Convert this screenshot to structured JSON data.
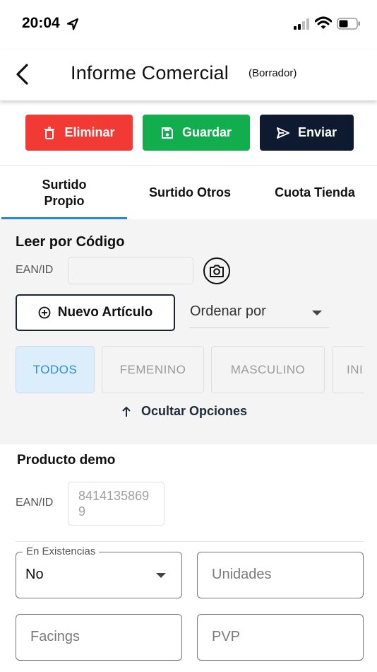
{
  "status_bar": {
    "time": "20:04",
    "icons": [
      "location-arrow-icon",
      "signal-icon",
      "wifi-icon",
      "battery-icon"
    ]
  },
  "header": {
    "title": "Informe Comercial",
    "subtitle": "(Borrador)",
    "back_icon": "chevron-left-icon"
  },
  "actions": {
    "delete_label": "Eliminar",
    "save_label": "Guardar",
    "send_label": "Enviar",
    "colors": {
      "delete": "#f03a33",
      "save": "#12ad4c",
      "send": "#0e1a30"
    }
  },
  "tabs": [
    {
      "line1": "Surtido",
      "line2": "Propio",
      "active": true
    },
    {
      "line1": "Surtido Otros",
      "line2": "",
      "active": false
    },
    {
      "line1": "Cuota Tienda",
      "line2": "",
      "active": false
    }
  ],
  "scan": {
    "title": "Leer por Código",
    "ean_label": "EAN/ID",
    "ean_value": ""
  },
  "new_article_label": "Nuevo Artículo",
  "sort": {
    "label": "Ordenar por"
  },
  "filters": [
    {
      "label": "TODOS",
      "active": true
    },
    {
      "label": "FEMENINO",
      "active": false
    },
    {
      "label": "MASCULINO",
      "active": false
    },
    {
      "label": "INI",
      "active": false
    }
  ],
  "hide_options_label": "Ocultar Opciones",
  "product": {
    "name": "Producto demo",
    "ean_label": "EAN/ID",
    "ean_value": "84141358699",
    "stock": {
      "legend": "En Existencias",
      "value": "No"
    },
    "units_placeholder": "Unidades",
    "facings_placeholder": "Facings",
    "pvp_placeholder": "PVP"
  },
  "theme": {
    "accent": "#2b86d9",
    "chip_active_bg": "#dceefb",
    "panel_bg": "#f4f4f4"
  }
}
